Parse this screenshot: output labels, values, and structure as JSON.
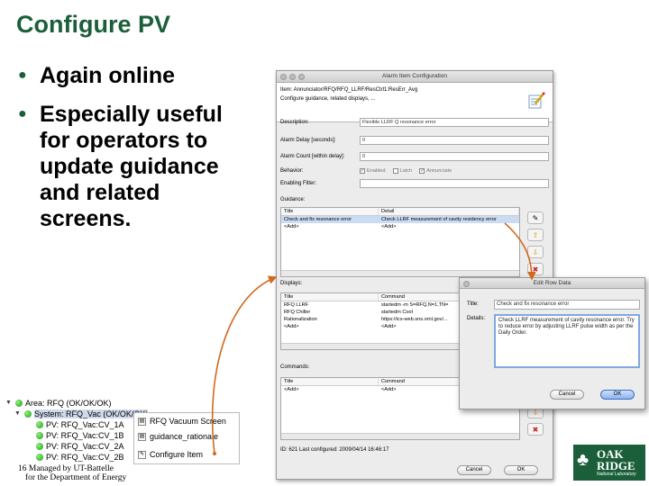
{
  "slide": {
    "title": "Configure PV",
    "bullets": [
      "Again online",
      "Especially useful for operators to update guidance and related screens."
    ],
    "footer_line1": "16  Managed by UT-Battelle",
    "footer_line2": "for the Department of Energy",
    "logo_line1": "OAK",
    "logo_line2": "RIDGE",
    "logo_sub": "National Laboratory"
  },
  "alarm_dialog": {
    "title": "Alarm Item Configuration",
    "item_path": "Item: Annunciator/RFQ/RFQ_LLRF/ResCtrl1:ResErr_Avg",
    "subtitle": "Configure guidance, related displays, ...",
    "description_label": "Description:",
    "description_value": "Flexible LLRF Q resonance error",
    "delay_label": "Alarm Delay [seconds]:",
    "delay_value": "0",
    "count_label": "Alarm Count [within delay]:",
    "count_value": "0",
    "behavior_label": "Behavior:",
    "behavior_enabled": "Enabled",
    "behavior_latch": "Latch",
    "behavior_annunciate": "Annunciate",
    "filter_label": "Enabling Filter:",
    "filter_value": "",
    "guidance_label": "Guidance:",
    "guidance_headers": [
      "Title",
      "Detail"
    ],
    "guidance_rows": [
      [
        "Check and fix resonance error",
        "Check LLRF measurement of cavity residency error"
      ],
      [
        "<Add>",
        "<Add>"
      ]
    ],
    "displays_label": "Displays:",
    "displays_headers": [
      "Title",
      "Command"
    ],
    "displays_rows": [
      [
        "RFQ LLRF",
        "startedm -m S=RFQ,N=1,TN="
      ],
      [
        "RFQ Chiller",
        "startedm Cool"
      ],
      [
        "Rationalization",
        "https://ics-web.sns.ornl.gov/..."
      ],
      [
        "<Add>",
        "<Add>"
      ]
    ],
    "commands_label": "Commands:",
    "commands_headers": [
      "Title",
      "Command"
    ],
    "commands_rows": [
      [
        "<Add>",
        "<Add>"
      ]
    ],
    "footer_info": "ID: 621  Last configured: 2009/04/14 16:46:17",
    "cancel_label": "Cancel",
    "ok_label": "OK"
  },
  "edit_row_dialog": {
    "title": "Edit Row Data",
    "title_label": "Title:",
    "title_value": "Check and fix resonance error",
    "details_label": "Details:",
    "details_value": "Check LLRF measurement of cavity resonance error. Try to reduce error by adjusting LLRF pulse width as per the Daily Order.",
    "cancel_label": "Cancel",
    "ok_label": "OK"
  },
  "alarm_tree": {
    "rows": [
      "Area: RFQ (OK/OK/OK)",
      "System: RFQ_Vac (OK/OK/OK)",
      "PV: RFQ_Vac:CV_1A",
      "PV: RFQ_Vac:CV_1B",
      "PV: RFQ_Vac:CV_2A",
      "PV: RFQ_Vac:CV_2B"
    ],
    "context_menu": [
      "RFQ Vacuum Screen",
      "guidance_rationale",
      "Configure Item"
    ]
  },
  "colors": {
    "title_green": "#1a5f3a",
    "arrow_orange": "#d2691e",
    "selection_blue": "#3875d7"
  }
}
